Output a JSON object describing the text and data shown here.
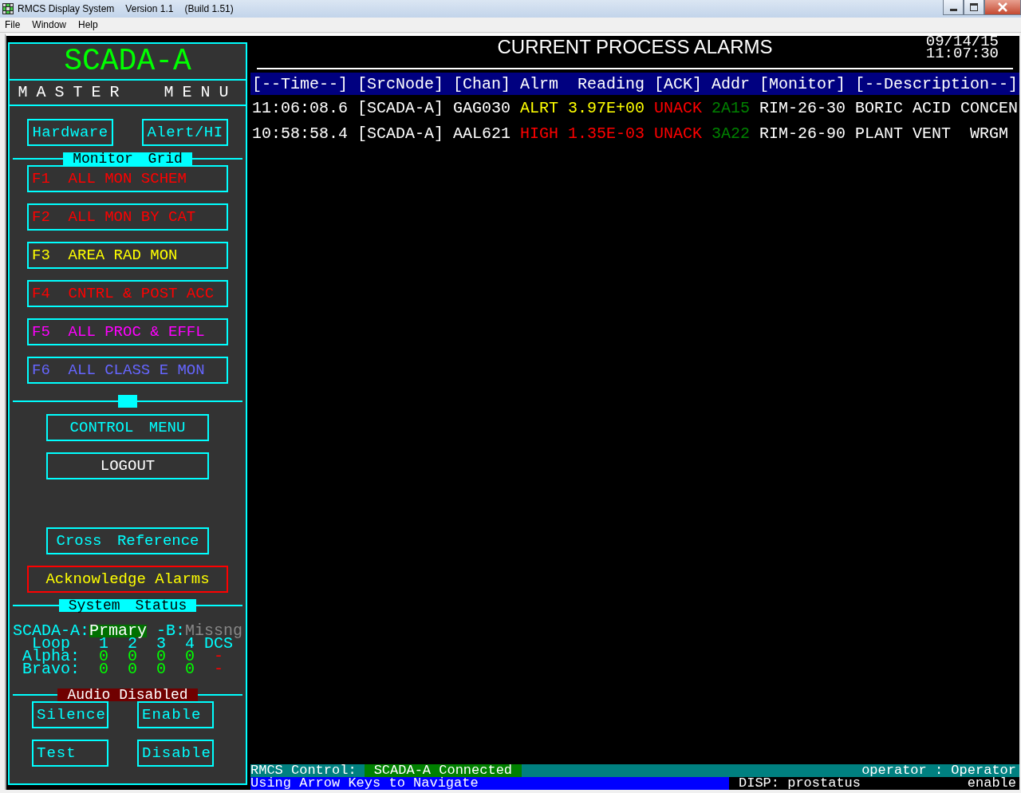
{
  "window": {
    "title": "RMCS Display System",
    "version": "Version 1.1",
    "build": "(Build 1.51)"
  },
  "menu_bar": [
    "File",
    "Window",
    "Help"
  ],
  "left_panel": {
    "title": "SCADA-A",
    "subtitle": "MASTER MENU",
    "top_buttons": [
      "Hardware",
      "Alert/HI"
    ],
    "grid_heading": "Monitor Grid",
    "grid_items": [
      {
        "key": "F1",
        "label": "ALL MON SCHEM",
        "color": "#ff0000"
      },
      {
        "key": "F2",
        "label": "ALL MON BY CAT",
        "color": "#ff0000"
      },
      {
        "key": "F3",
        "label": "AREA RAD MON",
        "color": "#ffff00"
      },
      {
        "key": "F4",
        "label": "CNTRL & POST ACC",
        "color": "#ff0000"
      },
      {
        "key": "F5",
        "label": "ALL PROC & EFFL",
        "color": "#ff00ff"
      },
      {
        "key": "F6",
        "label": "ALL CLASS E MON",
        "color": "#6666ff"
      }
    ],
    "menu_buttons": [
      {
        "label": "CONTROL MENU",
        "kind": "standard"
      },
      {
        "label": "LOGOUT",
        "kind": "plain"
      }
    ],
    "action_buttons": [
      {
        "label": "Cross Reference",
        "kind": "standard"
      },
      {
        "label": "Acknowledge Alarms",
        "kind": "alert"
      }
    ],
    "status_heading": "System Status",
    "node_status": [
      {
        "text": "SCADA-A:",
        "kind": "label"
      },
      {
        "text": "Prmary",
        "kind": "ok"
      },
      {
        "text": "-B:",
        "kind": "label"
      },
      {
        "text": "Missng",
        "kind": "missing"
      }
    ],
    "status_rows": [
      {
        "label": "Loop",
        "kind": "header",
        "values": [
          {
            "text": "1",
            "color": "#00ffff"
          },
          {
            "text": "2",
            "color": "#00ffff"
          },
          {
            "text": "3",
            "color": "#00ffff"
          },
          {
            "text": "4",
            "color": "#00ffff"
          },
          {
            "text": "DCS",
            "color": "#00ffff"
          }
        ]
      },
      {
        "label": "Alpha:",
        "kind": "data",
        "values": [
          {
            "text": "0",
            "color": "#00ff00"
          },
          {
            "text": "0",
            "color": "#00ff00"
          },
          {
            "text": "0",
            "color": "#00ff00"
          },
          {
            "text": "0",
            "color": "#00ff00"
          },
          {
            "text": "-",
            "color": "#ff0000"
          }
        ]
      },
      {
        "label": "Bravo:",
        "kind": "data",
        "values": [
          {
            "text": "0",
            "color": "#00ff00"
          },
          {
            "text": "0",
            "color": "#00ff00"
          },
          {
            "text": "0",
            "color": "#00ff00"
          },
          {
            "text": "0",
            "color": "#00ff00"
          },
          {
            "text": "-",
            "color": "#ff0000"
          }
        ]
      }
    ],
    "audio_heading": "Audio Disabled",
    "audio_buttons": [
      "Silence",
      "Enable",
      "Test",
      "Disable"
    ]
  },
  "alarms": {
    "title": "CURRENT PROCESS ALARMS",
    "date": "09/14/15",
    "time": "11:07:30",
    "columns": [
      "[--Time--]",
      "[SrcNode]",
      "[Chan]",
      "Alrm",
      "Reading",
      "[ACK]",
      "Addr",
      "[Monitor]",
      "[--Description--]"
    ],
    "rows": [
      [
        {
          "text": "11:06:08.6",
          "color": "#ffffff"
        },
        {
          "text": "[SCADA-A]",
          "color": "#ffffff"
        },
        {
          "text": "GAG030",
          "color": "#ffffff"
        },
        {
          "text": "ALRT",
          "color": "#ffff00"
        },
        {
          "text": "3.97E+00",
          "color": "#ffff00"
        },
        {
          "text": "UNACK",
          "color": "#ff0000"
        },
        {
          "text": "2A15",
          "color": "#008000"
        },
        {
          "text": "RIM-26-30",
          "color": "#ffffff"
        },
        {
          "text": "BORIC ACID CONCEN",
          "color": "#ffffff"
        }
      ],
      [
        {
          "text": "10:58:58.4",
          "color": "#ffffff"
        },
        {
          "text": "[SCADA-A]",
          "color": "#ffffff"
        },
        {
          "text": "AAL621",
          "color": "#ffffff"
        },
        {
          "text": "HIGH",
          "color": "#ff0000"
        },
        {
          "text": "1.35E-03",
          "color": "#ff0000"
        },
        {
          "text": "UNACK",
          "color": "#ff0000"
        },
        {
          "text": "3A22",
          "color": "#008000"
        },
        {
          "text": "RIM-26-90",
          "color": "#ffffff"
        },
        {
          "text": "PLANT VENT  WRGM",
          "color": "#ffffff"
        }
      ]
    ]
  },
  "status_bar": {
    "control_label": "RMCS Control:",
    "connection": "SCADA-A Connected",
    "user": "operator : Operator",
    "hint": "Using Arrow Keys to Navigate",
    "display": "DISP: prostatus",
    "mode": "enable"
  }
}
